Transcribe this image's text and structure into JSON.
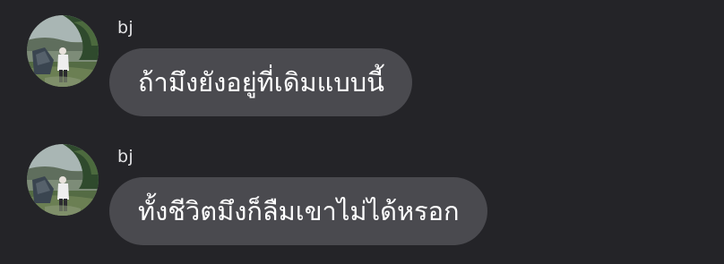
{
  "messages": [
    {
      "sender": "bj",
      "text": "ถ้ามึงยังอยู่ที่เดิมแบบนี้",
      "avatar_icon": "profile-photo-icon"
    },
    {
      "sender": "bj",
      "text": "ทั้งชีวิตมึงก็ลืมเขาไม่ได้หรอก",
      "avatar_icon": "profile-photo-icon"
    }
  ],
  "colors": {
    "background": "#242428",
    "bubble": "#4a4a4f",
    "sender_text": "#e4e4e6",
    "message_text": "#ffffff"
  }
}
